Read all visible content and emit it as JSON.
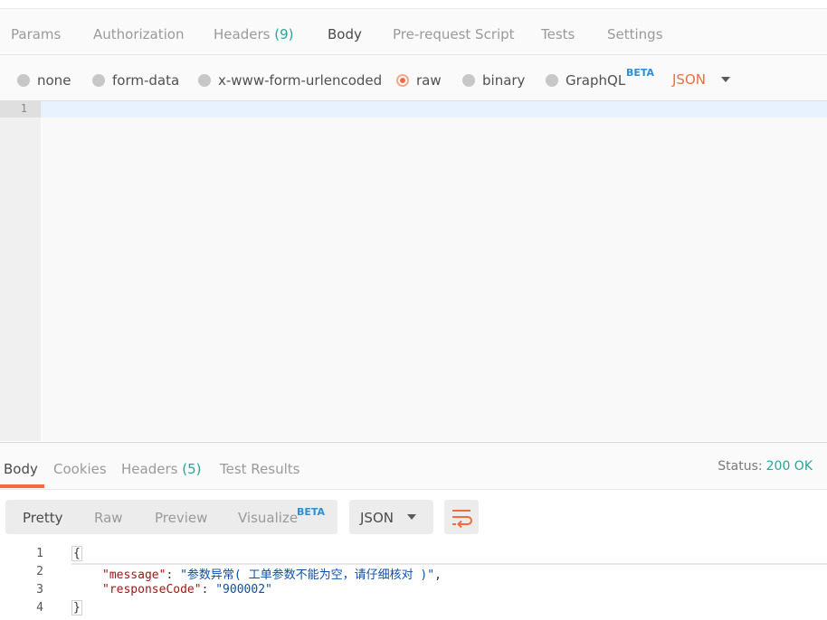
{
  "request_tabs": [
    {
      "label": "Params"
    },
    {
      "label": "Authorization"
    },
    {
      "label": "Headers",
      "count": "(9)"
    },
    {
      "label": "Body",
      "active": true
    },
    {
      "label": "Pre-request Script"
    },
    {
      "label": "Tests"
    },
    {
      "label": "Settings"
    }
  ],
  "body_types": [
    {
      "label": "none"
    },
    {
      "label": "form-data"
    },
    {
      "label": "x-www-form-urlencoded"
    },
    {
      "label": "raw",
      "selected": true
    },
    {
      "label": "binary"
    },
    {
      "label": "GraphQL",
      "badge": "BETA"
    }
  ],
  "raw_language": "JSON",
  "editor": {
    "lines": [
      "1"
    ]
  },
  "response_tabs": [
    {
      "label": "Body",
      "active": true
    },
    {
      "label": "Cookies"
    },
    {
      "label": "Headers",
      "count": "(5)"
    },
    {
      "label": "Test Results"
    }
  ],
  "status": {
    "label": "Status:",
    "value": "200 OK"
  },
  "view_modes": [
    {
      "label": "Pretty",
      "active": true
    },
    {
      "label": "Raw"
    },
    {
      "label": "Preview"
    },
    {
      "label": "Visualize",
      "badge": "BETA"
    }
  ],
  "response_format": "JSON",
  "response_lines": [
    {
      "n": "1",
      "brace": "{"
    },
    {
      "n": "2",
      "key": "\"message\"",
      "sep": ": ",
      "val": "\"参数异常( 工单参数不能为空，请仔细核对 )\"",
      "tail": ","
    },
    {
      "n": "3",
      "key": "\"responseCode\"",
      "sep": ": ",
      "val": "\"900002\"",
      "tail": ""
    },
    {
      "n": "4",
      "brace": "}"
    }
  ],
  "colors": {
    "accent": "#f26b3a",
    "success": "#26a69a",
    "beta": "#2b8fd8"
  }
}
